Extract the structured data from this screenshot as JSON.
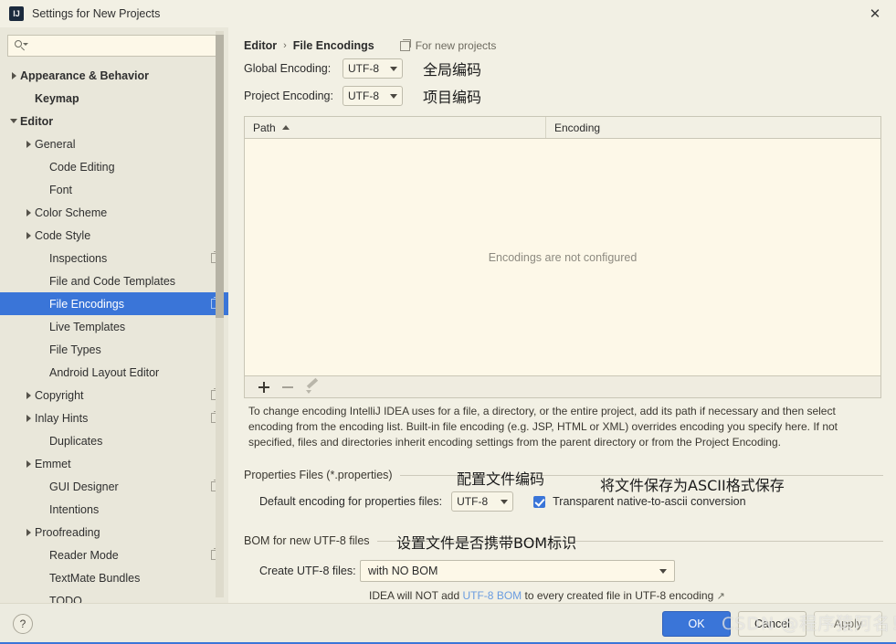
{
  "window": {
    "title": "Settings for New Projects",
    "app_icon": "intellij-idea-icon",
    "close_icon": "close-icon"
  },
  "search": {
    "value": "",
    "placeholder": "",
    "icon": "search-icon"
  },
  "sidebar": {
    "items": [
      {
        "label": "Appearance & Behavior",
        "arrow": "right",
        "bold": true,
        "indent": 0,
        "selected": false,
        "badge": false
      },
      {
        "label": "Keymap",
        "arrow": "none",
        "bold": true,
        "indent": 1,
        "selected": false,
        "badge": false
      },
      {
        "label": "Editor",
        "arrow": "down",
        "bold": true,
        "indent": 0,
        "selected": false,
        "badge": false
      },
      {
        "label": "General",
        "arrow": "right",
        "bold": false,
        "indent": 1,
        "selected": false,
        "badge": false
      },
      {
        "label": "Code Editing",
        "arrow": "none",
        "bold": false,
        "indent": 2,
        "selected": false,
        "badge": false
      },
      {
        "label": "Font",
        "arrow": "none",
        "bold": false,
        "indent": 2,
        "selected": false,
        "badge": false
      },
      {
        "label": "Color Scheme",
        "arrow": "right",
        "bold": false,
        "indent": 1,
        "selected": false,
        "badge": false
      },
      {
        "label": "Code Style",
        "arrow": "right",
        "bold": false,
        "indent": 1,
        "selected": false,
        "badge": false
      },
      {
        "label": "Inspections",
        "arrow": "none",
        "bold": false,
        "indent": 2,
        "selected": false,
        "badge": true
      },
      {
        "label": "File and Code Templates",
        "arrow": "none",
        "bold": false,
        "indent": 2,
        "selected": false,
        "badge": false
      },
      {
        "label": "File Encodings",
        "arrow": "none",
        "bold": false,
        "indent": 2,
        "selected": true,
        "badge": true
      },
      {
        "label": "Live Templates",
        "arrow": "none",
        "bold": false,
        "indent": 2,
        "selected": false,
        "badge": false
      },
      {
        "label": "File Types",
        "arrow": "none",
        "bold": false,
        "indent": 2,
        "selected": false,
        "badge": false
      },
      {
        "label": "Android Layout Editor",
        "arrow": "none",
        "bold": false,
        "indent": 2,
        "selected": false,
        "badge": false
      },
      {
        "label": "Copyright",
        "arrow": "right",
        "bold": false,
        "indent": 1,
        "selected": false,
        "badge": true
      },
      {
        "label": "Inlay Hints",
        "arrow": "right",
        "bold": false,
        "indent": 1,
        "selected": false,
        "badge": true
      },
      {
        "label": "Duplicates",
        "arrow": "none",
        "bold": false,
        "indent": 2,
        "selected": false,
        "badge": false
      },
      {
        "label": "Emmet",
        "arrow": "right",
        "bold": false,
        "indent": 1,
        "selected": false,
        "badge": false
      },
      {
        "label": "GUI Designer",
        "arrow": "none",
        "bold": false,
        "indent": 2,
        "selected": false,
        "badge": true
      },
      {
        "label": "Intentions",
        "arrow": "none",
        "bold": false,
        "indent": 2,
        "selected": false,
        "badge": false
      },
      {
        "label": "Proofreading",
        "arrow": "right",
        "bold": false,
        "indent": 1,
        "selected": false,
        "badge": false
      },
      {
        "label": "Reader Mode",
        "arrow": "none",
        "bold": false,
        "indent": 2,
        "selected": false,
        "badge": true
      },
      {
        "label": "TextMate Bundles",
        "arrow": "none",
        "bold": false,
        "indent": 2,
        "selected": false,
        "badge": false
      },
      {
        "label": "TODO",
        "arrow": "none",
        "bold": false,
        "indent": 2,
        "selected": false,
        "badge": false
      }
    ]
  },
  "breadcrumb": {
    "parent": "Editor",
    "separator": "›",
    "current": "File Encodings",
    "scope_label": "For new projects",
    "scope_icon": "stack-icon"
  },
  "encoding": {
    "global_label": "Global Encoding:",
    "global_value": "UTF-8",
    "global_note_cn": "全局编码",
    "project_label": "Project Encoding:",
    "project_value": "UTF-8",
    "project_note_cn": "项目编码"
  },
  "table": {
    "columns": [
      "Path",
      "Encoding"
    ],
    "sort_column": "Path",
    "sort_direction": "ascending",
    "rows": [],
    "empty_text": "Encodings are not configured",
    "toolbar": {
      "add": "add-row-button",
      "remove": "remove-row-button",
      "edit": "edit-row-button"
    }
  },
  "description": "To change encoding IntelliJ IDEA uses for a file, a directory, or the entire project, add its path if necessary and then select encoding from the encoding list. Built-in file encoding (e.g. JSP, HTML or XML) overrides encoding you specify here. If not specified, files and directories inherit encoding settings from the parent directory or from the Project Encoding.",
  "properties_section": {
    "title": "Properties Files (*.properties)",
    "title_note_cn": "配置文件编码",
    "default_encoding_label": "Default encoding for properties files:",
    "default_encoding_value": "UTF-8",
    "transparent_label": "Transparent native-to-ascii conversion",
    "transparent_checked": true,
    "transparent_note_cn": "将文件保存为ASCII格式保存"
  },
  "bom_section": {
    "title": "BOM for new UTF-8 files",
    "title_note_cn": "设置文件是否携带BOM标识",
    "create_label": "Create UTF-8 files:",
    "create_value": "with NO BOM",
    "hint_prefix": "IDEA will NOT add ",
    "hint_link": "UTF-8 BOM",
    "hint_suffix": " to every created file in UTF-8 encoding",
    "hint_arrow": "↗"
  },
  "footer": {
    "help_label": "?",
    "ok_label": "OK",
    "cancel_label": "Cancel",
    "apply_label": "Apply"
  },
  "watermark": "CSDN @程序猿阿名！",
  "colors": {
    "accent_blue": "#3a75d8",
    "panel_bg": "#f2f0e4",
    "sidebar_bg": "#e9e7da",
    "field_bg": "#fdf8e8",
    "link_blue": "#6a9ce0"
  }
}
